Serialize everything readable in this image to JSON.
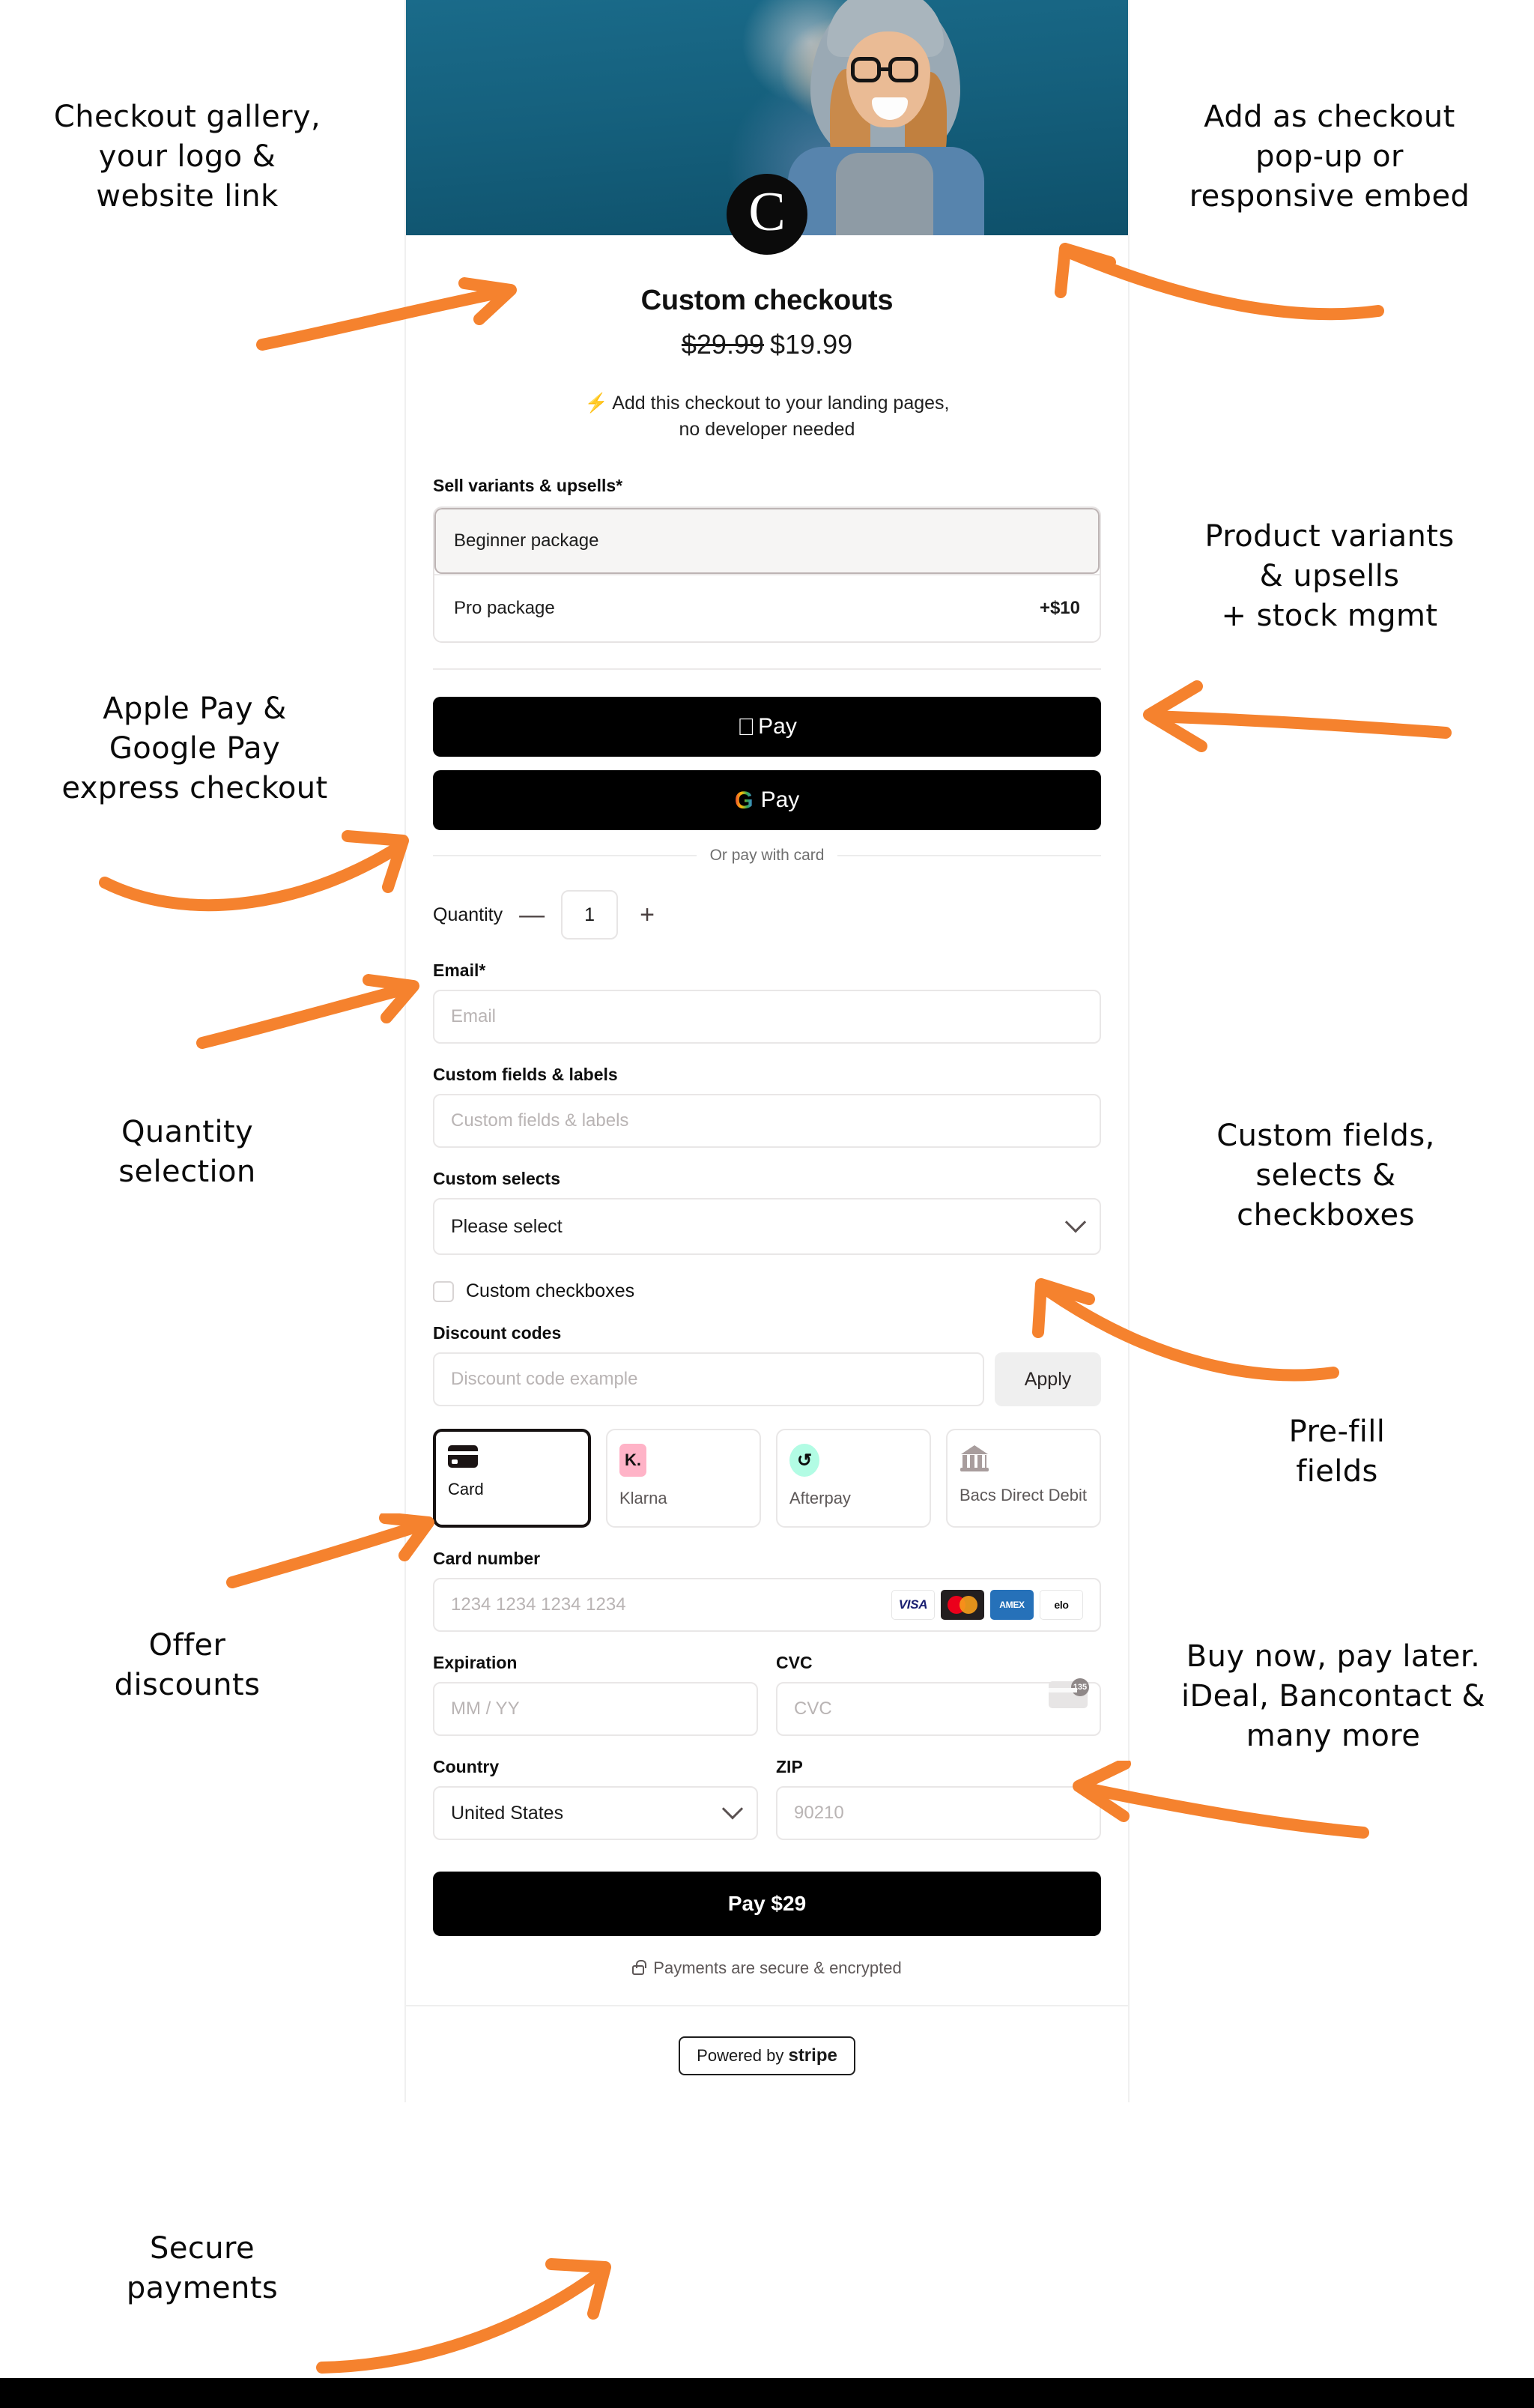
{
  "checkout": {
    "logo_glyph": "C",
    "product_title": "Custom checkouts",
    "price_old": "$29.99",
    "price_new": "$19.99",
    "tagline_icon": "⚡",
    "tagline_line1": "Add this checkout to your landing pages,",
    "tagline_line2": "no developer needed",
    "variants": {
      "label": "Sell variants & upsells*",
      "options": [
        {
          "name": "Beginner package",
          "price": "",
          "selected": true
        },
        {
          "name": "Pro package",
          "price": "+$10",
          "selected": false
        }
      ]
    },
    "express": {
      "apple_pay_label": "Pay",
      "apple_icon": "",
      "google_pay_label": "Pay",
      "google_icon": "G",
      "divider_text": "Or pay with card"
    },
    "quantity": {
      "label": "Quantity",
      "minus": "—",
      "value": "1",
      "plus": "+"
    },
    "email": {
      "label": "Email*",
      "placeholder": "Email",
      "value": ""
    },
    "custom_fields": {
      "label": "Custom fields & labels",
      "placeholder": "Custom fields & labels",
      "value": ""
    },
    "custom_selects": {
      "label": "Custom selects",
      "selected": "Please select"
    },
    "custom_checkbox": {
      "label": "Custom checkboxes",
      "checked": false
    },
    "discount": {
      "label": "Discount codes",
      "placeholder": "Discount code example",
      "value": "",
      "apply_label": "Apply"
    },
    "payment_methods": [
      {
        "name": "Card",
        "icon": "credit-card-icon",
        "active": true
      },
      {
        "name": "Klarna",
        "icon": "klarna-icon",
        "active": false
      },
      {
        "name": "Afterpay",
        "icon": "afterpay-icon",
        "active": false
      },
      {
        "name": "Bacs Direct Debit",
        "icon": "bank-icon",
        "active": false
      }
    ],
    "card_number": {
      "label": "Card number",
      "placeholder": "1234 1234 1234 1234",
      "value": "",
      "brands": [
        "VISA",
        "mastercard",
        "AMEX",
        "elo"
      ],
      "brand_amex_line1": "AM",
      "brand_amex_line2": "EX"
    },
    "expiration": {
      "label": "Expiration",
      "placeholder": "MM / YY",
      "value": ""
    },
    "cvc": {
      "label": "CVC",
      "placeholder": "CVC",
      "value": "",
      "icon_digits": "135"
    },
    "country": {
      "label": "Country",
      "selected": "United States"
    },
    "zip": {
      "label": "ZIP",
      "placeholder": "90210",
      "value": ""
    },
    "pay_button": "Pay $29",
    "secure_text": "Payments are secure & encrypted",
    "footer_badge_prefix": "Powered by",
    "footer_badge_brand": "stripe"
  },
  "annotations": {
    "accent_color": "#f5822e",
    "items": [
      {
        "id": "checkout-gallery",
        "lines": [
          "Checkout gallery,",
          "your logo &",
          "website link"
        ]
      },
      {
        "id": "add-as-popup",
        "lines": [
          "Add as checkout",
          "pop-up or",
          "responsive embed"
        ]
      },
      {
        "id": "product-variants",
        "lines": [
          "Product variants",
          "& upsells",
          "+ stock mgmt"
        ]
      },
      {
        "id": "express-checkout",
        "lines": [
          "Apple Pay &",
          "Google Pay",
          "express checkout"
        ]
      },
      {
        "id": "quantity-selection",
        "lines": [
          "Quantity",
          "selection"
        ]
      },
      {
        "id": "custom-fields",
        "lines": [
          "Custom fields,",
          "selects &",
          "checkboxes"
        ]
      },
      {
        "id": "pre-fill-fields",
        "lines": [
          "Pre-fill",
          "fields"
        ]
      },
      {
        "id": "offer-discounts",
        "lines": [
          "Offer",
          "discounts"
        ]
      },
      {
        "id": "buy-now-pay-later",
        "lines": [
          "Buy now, pay later.",
          "iDeal, Bancontact &",
          "many more"
        ]
      },
      {
        "id": "secure-payments",
        "lines": [
          "Secure",
          "payments"
        ]
      }
    ]
  }
}
